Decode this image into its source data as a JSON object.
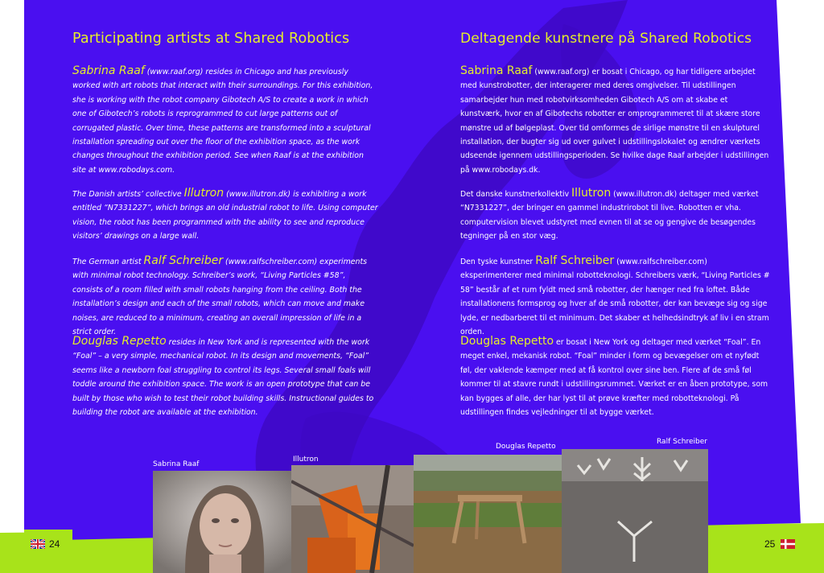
{
  "left_page": {
    "heading": "Participating artists at Shared Robotics",
    "paragraphs": [
      {
        "name": "Sabrina Raaf",
        "text": " (www.raaf.org) resides in Chicago and has previously worked with art robots that interact with their surroundings. For this exhibition, she is working with the robot company Gibotech A/S to create a work in which one of Gibotech’s robots is reprogrammed to cut large patterns out of corrugated plastic. Over time, these patterns are transformed into a sculptural installation spreading out over the floor of the exhibition space, as the work changes throughout the exhibition period. See when Raaf is at the exhibition site at www.robodays.com."
      },
      {
        "prefix": "The Danish artists’ collective ",
        "name": "Illutron",
        "text": " (www.illutron.dk) is exhibiting a work entitled “N7331227”, which brings an old industrial robot to life. Using computer vision, the robot has been programmed with the ability to see and reproduce visitors’ drawings on a large wall."
      },
      {
        "prefix": "The German artist ",
        "name": "Ralf Schreiber",
        "text": " (www.ralfschreiber.com) experiments with minimal robot technology. Schreiber’s work, “Living Particles #58”, consists of a room filled with small robots hanging from the ceiling. Both the installation’s design and each of the small robots, which can move and make noises, are reduced to a minimum, creating an overall impression of life in a strict order."
      },
      {
        "name": "Douglas Repetto",
        "text": " resides in New York and is represented with the work “Foal” – a very simple, mechanical robot. In its design and movements, “Foal” seems like a newborn foal struggling to control its legs. Several small foals will toddle around the exhibition space. The work is an open prototype that can be built by those who wish to test their robot building skills. Instructional guides to building the robot are available at the exhibition."
      }
    ],
    "page_number": "24"
  },
  "right_page": {
    "heading": "Deltagende kunstnere på Shared Robotics",
    "paragraphs": [
      {
        "name": "Sabrina Raaf",
        "text": " (www.raaf.org) er bosat i Chicago, og har tidligere arbejdet med kunstrobotter, der interagerer med deres omgivelser. Til udstillingen samarbejder hun med robotvirksomheden Gibotech A/S om at skabe et kunstværk, hvor en af Gibotechs robotter er omprogrammeret til at skære store mønstre ud af bølgeplast. Over tid omformes de sirlige mønstre til en skulpturel installation, der bugter sig ud over gulvet i udstillingslokalet og ændrer værkets udseende igennem udstillingsperioden. Se hvilke dage Raaf arbejder i udstillingen på www.robodays.dk."
      },
      {
        "prefix": "Det danske kunstnerkollektiv ",
        "name": "Illutron",
        "text": " (www.illutron.dk) deltager med værket “N7331227”, der bringer en gammel industrirobot til live. Robotten er vha. computervision blevet udstyret med evnen til at se og gengive de besøgendes tegninger på en stor væg."
      },
      {
        "prefix": "Den tyske kunstner ",
        "name": "Ralf Schreiber",
        "text": " (www.ralfschreiber.com) eksperimenterer med minimal robotteknologi. Schreibers værk, “Living Particles # 58” består af et rum fyldt med små robotter, der hænger ned fra loftet. Både installationens formsprog og hver af de små robotter, der kan bevæge sig og sige lyde, er nedbarberet til et minimum. Det skaber et helhedsindtryk af liv i en stram orden."
      },
      {
        "name": "Douglas Repetto",
        "text": " er bosat i New York og deltager med værket “Foal”. En meget enkel, mekanisk robot. “Foal” minder i form og bevægelser om et nyfødt føl, der vaklende kæmper med at få kontrol over sine ben. Flere af de små føl kommer til at stavre rundt i udstillingsrummet. Værket er en åben prototype, som kan bygges af alle, der har lyst til at prøve kræfter med robotteknologi. På udstillingen findes vejledninger til at bygge værket."
      }
    ],
    "page_number": "25"
  },
  "captions": [
    "Sabrina Raaf",
    "Illutron",
    "Douglas Repetto",
    "Ralf Schreiber"
  ],
  "colors": {
    "background_purple": "#4a0ff0",
    "lime": "#a8e31a",
    "heading_yellow": "#e5ee2a",
    "shadow_purple": "#3d08c2"
  },
  "icons": {
    "left_flag": "uk-flag-icon",
    "right_flag": "danish-flag-icon"
  }
}
